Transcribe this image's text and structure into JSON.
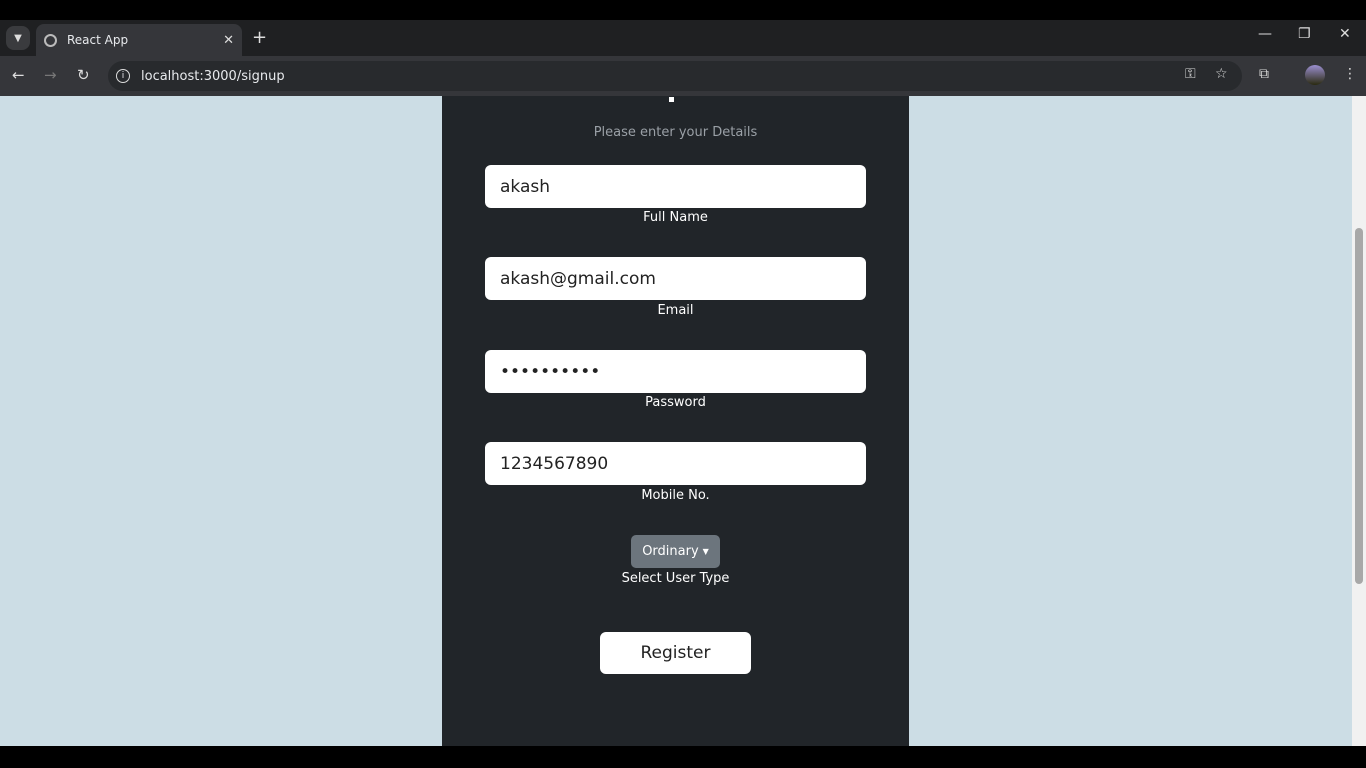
{
  "browser": {
    "tab_title": "React App",
    "url": "localhost:3000/signup"
  },
  "form": {
    "subtitle": "Please enter your Details",
    "full_name": {
      "value": "akash",
      "label": "Full Name"
    },
    "email": {
      "value": "akash@gmail.com",
      "label": "Email"
    },
    "password": {
      "value": "••••••••••",
      "label": "Password"
    },
    "mobile": {
      "value": "1234567890",
      "label": "Mobile No."
    },
    "user_type": {
      "selected": "Ordinary",
      "label": "Select User Type"
    },
    "register_label": "Register"
  }
}
